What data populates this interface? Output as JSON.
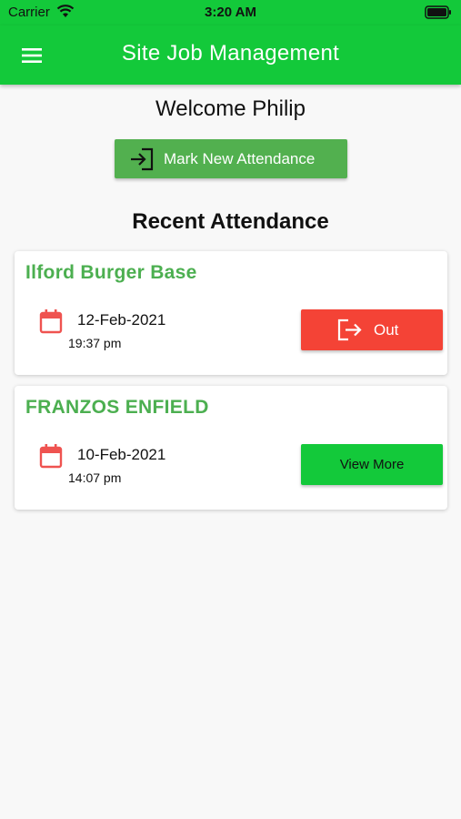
{
  "status_bar": {
    "carrier": "Carrier",
    "time": "3:20 AM"
  },
  "app_bar": {
    "title": "Site Job Management",
    "menu_icon": "hamburger-menu-icon"
  },
  "welcome": "Welcome Philip",
  "mark_attendance_button": {
    "label": "Mark New Attendance",
    "icon": "sign-in-icon"
  },
  "recent_title": "Recent Attendance",
  "attendance": [
    {
      "site": "Ilford Burger Base",
      "date": "12-Feb-2021",
      "time": "19:37 pm",
      "action_label": "Out",
      "action_icon": "sign-out-icon"
    },
    {
      "site": "FRANZOS ENFIELD",
      "date": "10-Feb-2021",
      "time": "14:07 pm",
      "action_label": "View More"
    }
  ],
  "colors": {
    "primary": "#13c93a",
    "accent_green": "#4caf50",
    "danger": "#f44336",
    "calendar_icon": "#ef5350"
  }
}
